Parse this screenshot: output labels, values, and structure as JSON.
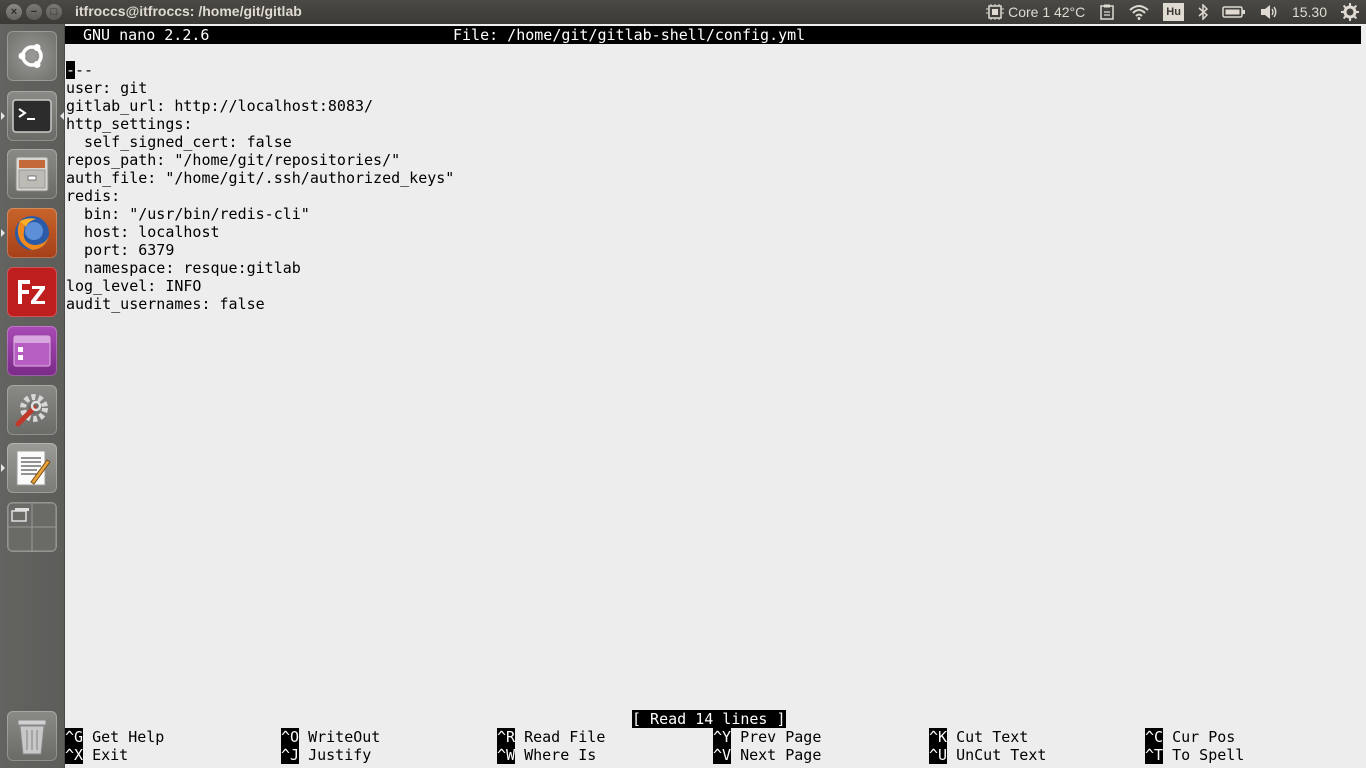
{
  "window": {
    "title": "itfroccs@itfroccs: /home/git/gitlab",
    "controls": [
      "close",
      "minimize",
      "maximize"
    ]
  },
  "indicators": {
    "cpu_label": "Core 1 42°C",
    "keyboard_layout": "Hu",
    "clock": "15.30",
    "icons": [
      "cpu-chip-icon",
      "clipboard-icon",
      "wifi-icon",
      "bluetooth-icon",
      "battery-icon",
      "volume-icon",
      "settings-gear-icon"
    ]
  },
  "launcher": {
    "items": [
      {
        "name": "ubuntu-dash",
        "icon": "ubuntu-logo-icon"
      },
      {
        "name": "terminal",
        "icon": "terminal-icon",
        "running": true,
        "focused": true
      },
      {
        "name": "files",
        "icon": "file-cabinet-icon"
      },
      {
        "name": "firefox",
        "icon": "firefox-icon",
        "running": true
      },
      {
        "name": "filezilla",
        "icon": "filezilla-icon"
      },
      {
        "name": "ubuntu-software",
        "icon": "software-center-icon"
      },
      {
        "name": "system-settings",
        "icon": "wrench-gear-icon"
      },
      {
        "name": "text-editor",
        "icon": "text-editor-icon",
        "running": true
      },
      {
        "name": "workspace-switcher",
        "icon": "workspace-switcher-icon"
      },
      {
        "name": "trash",
        "icon": "trash-icon"
      }
    ]
  },
  "nano": {
    "version_label": "GNU nano 2.2.6",
    "file_label": "File: /home/git/gitlab-shell/config.yml",
    "cursor_char": "-",
    "first_line_rest": "--",
    "lines": [
      "user: git",
      "gitlab_url: http://localhost:8083/",
      "http_settings:",
      "  self_signed_cert: false",
      "repos_path: \"/home/git/repositories/\"",
      "auth_file: \"/home/git/.ssh/authorized_keys\"",
      "redis:",
      "  bin: \"/usr/bin/redis-cli\"",
      "  host: localhost",
      "  port: 6379",
      "  namespace: resque:gitlab",
      "log_level: INFO",
      "audit_usernames: false"
    ],
    "status_message": "[ Read 14 lines ]",
    "shortcuts": [
      {
        "key": "^G",
        "label": "Get Help"
      },
      {
        "key": "^O",
        "label": "WriteOut"
      },
      {
        "key": "^R",
        "label": "Read File"
      },
      {
        "key": "^Y",
        "label": "Prev Page"
      },
      {
        "key": "^K",
        "label": "Cut Text"
      },
      {
        "key": "^C",
        "label": "Cur Pos"
      },
      {
        "key": "^X",
        "label": "Exit"
      },
      {
        "key": "^J",
        "label": "Justify"
      },
      {
        "key": "^W",
        "label": "Where Is"
      },
      {
        "key": "^V",
        "label": "Next Page"
      },
      {
        "key": "^U",
        "label": "UnCut Text"
      },
      {
        "key": "^T",
        "label": "To Spell"
      }
    ]
  },
  "colors": {
    "panel_bg": "#3b3a36",
    "launcher_bg": "#5f5f5c",
    "terminal_bg": "#ededed",
    "inverse_bg": "#000000",
    "inverse_fg": "#ffffff"
  }
}
